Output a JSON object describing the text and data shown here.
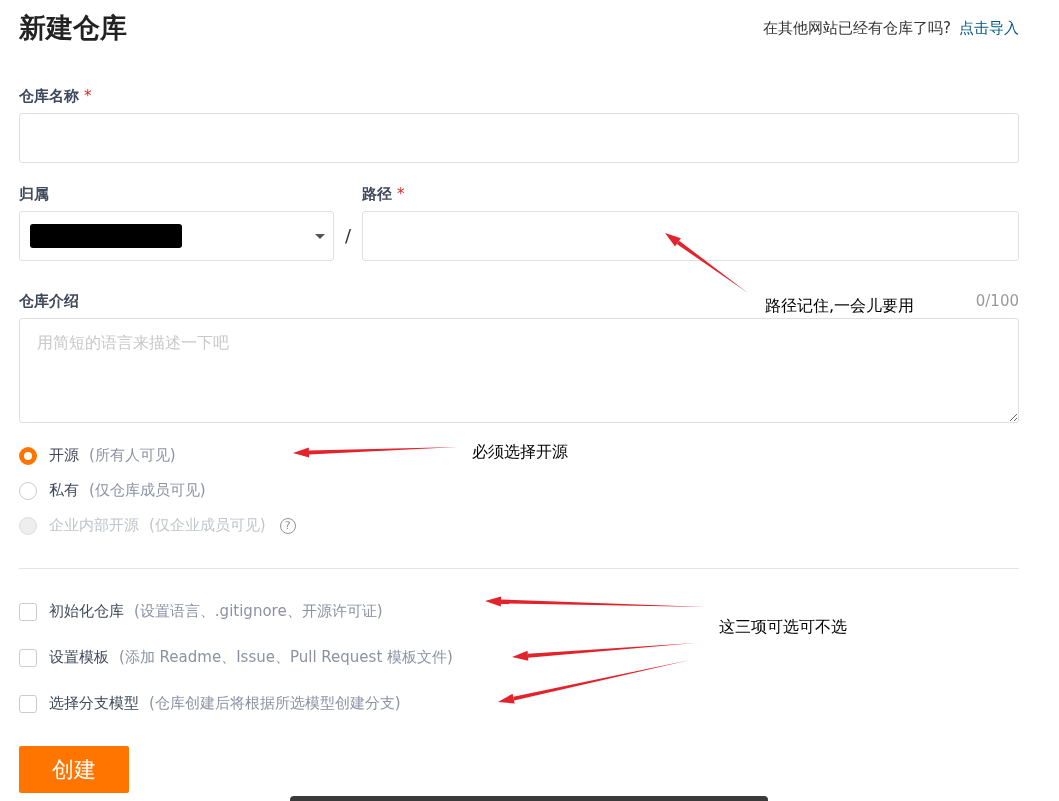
{
  "header": {
    "title": "新建仓库",
    "import_prompt": "在其他网站已经有仓库了吗?",
    "import_link": "点击导入"
  },
  "repo_name": {
    "label": "仓库名称",
    "required_mark": "*"
  },
  "owner": {
    "label": "归属"
  },
  "separator": "/",
  "path": {
    "label": "路径",
    "required_mark": "*"
  },
  "description": {
    "label": "仓库介绍",
    "counter": "0/100",
    "placeholder": "用简短的语言来描述一下吧"
  },
  "visibility": [
    {
      "label": "开源",
      "hint": "(所有人可见)",
      "selected": true,
      "disabled": false
    },
    {
      "label": "私有",
      "hint": "(仅仓库成员可见)",
      "selected": false,
      "disabled": false
    },
    {
      "label": "企业内部开源",
      "hint": "(仅企业成员可见)",
      "selected": false,
      "disabled": true,
      "help_icon": "?"
    }
  ],
  "options": [
    {
      "label": "初始化仓库",
      "hint": "(设置语言、.gitignore、开源许可证)",
      "checked": false
    },
    {
      "label": "设置模板",
      "hint": "(添加 Readme、Issue、Pull Request 模板文件)",
      "checked": false
    },
    {
      "label": "选择分支模型",
      "hint": "(仓库创建后将根据所选模型创建分支)",
      "checked": false
    }
  ],
  "create_button": "创建",
  "annotations": [
    {
      "text": "路径记住,一会儿要用"
    },
    {
      "text": "必须选择开源"
    },
    {
      "text": "这三项可选可不选"
    }
  ]
}
